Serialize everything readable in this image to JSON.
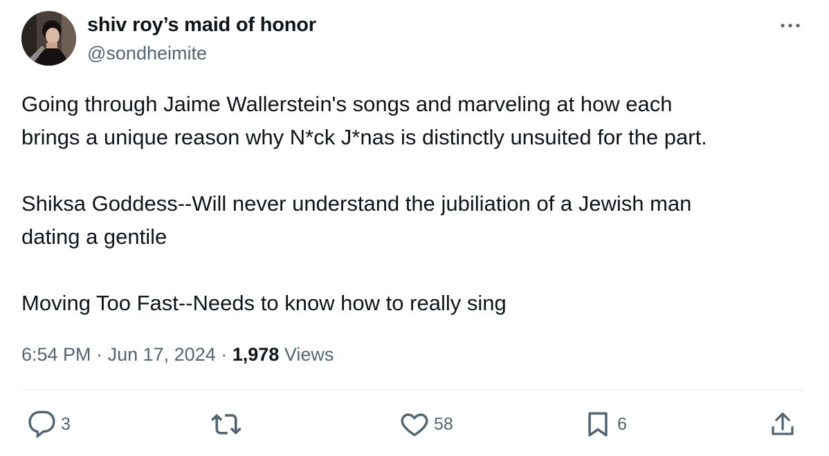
{
  "author": {
    "display_name": "shiv roy’s maid of honor",
    "handle": "@sondheimite",
    "avatar": "profile-photo"
  },
  "more_icon": "more-horizontal-icon",
  "tweet": {
    "lines": [
      "Going through Jaime Wallerstein's songs and marveling at how each",
      "brings a unique reason why N*ck J*nas is distinctly unsuited for the part.",
      "Shiksa Goddess--Will never understand the jubiliation of a Jewish man",
      "dating a gentile",
      "Moving Too Fast--Needs to know how to really sing"
    ]
  },
  "meta": {
    "time": "6:54 PM",
    "separator": "·",
    "date": "Jun 17, 2024",
    "views_count": "1,978",
    "views_label": "Views"
  },
  "actions": {
    "reply": {
      "icon": "reply-icon",
      "count": "3"
    },
    "retweet": {
      "icon": "retweet-icon",
      "count": ""
    },
    "like": {
      "icon": "heart-icon",
      "count": "58"
    },
    "bookmark": {
      "icon": "bookmark-icon",
      "count": "6"
    },
    "share": {
      "icon": "share-icon",
      "count": ""
    }
  },
  "colors": {
    "text_primary": "#0f1419",
    "text_secondary": "#536471",
    "divider": "#e4e9ec"
  }
}
